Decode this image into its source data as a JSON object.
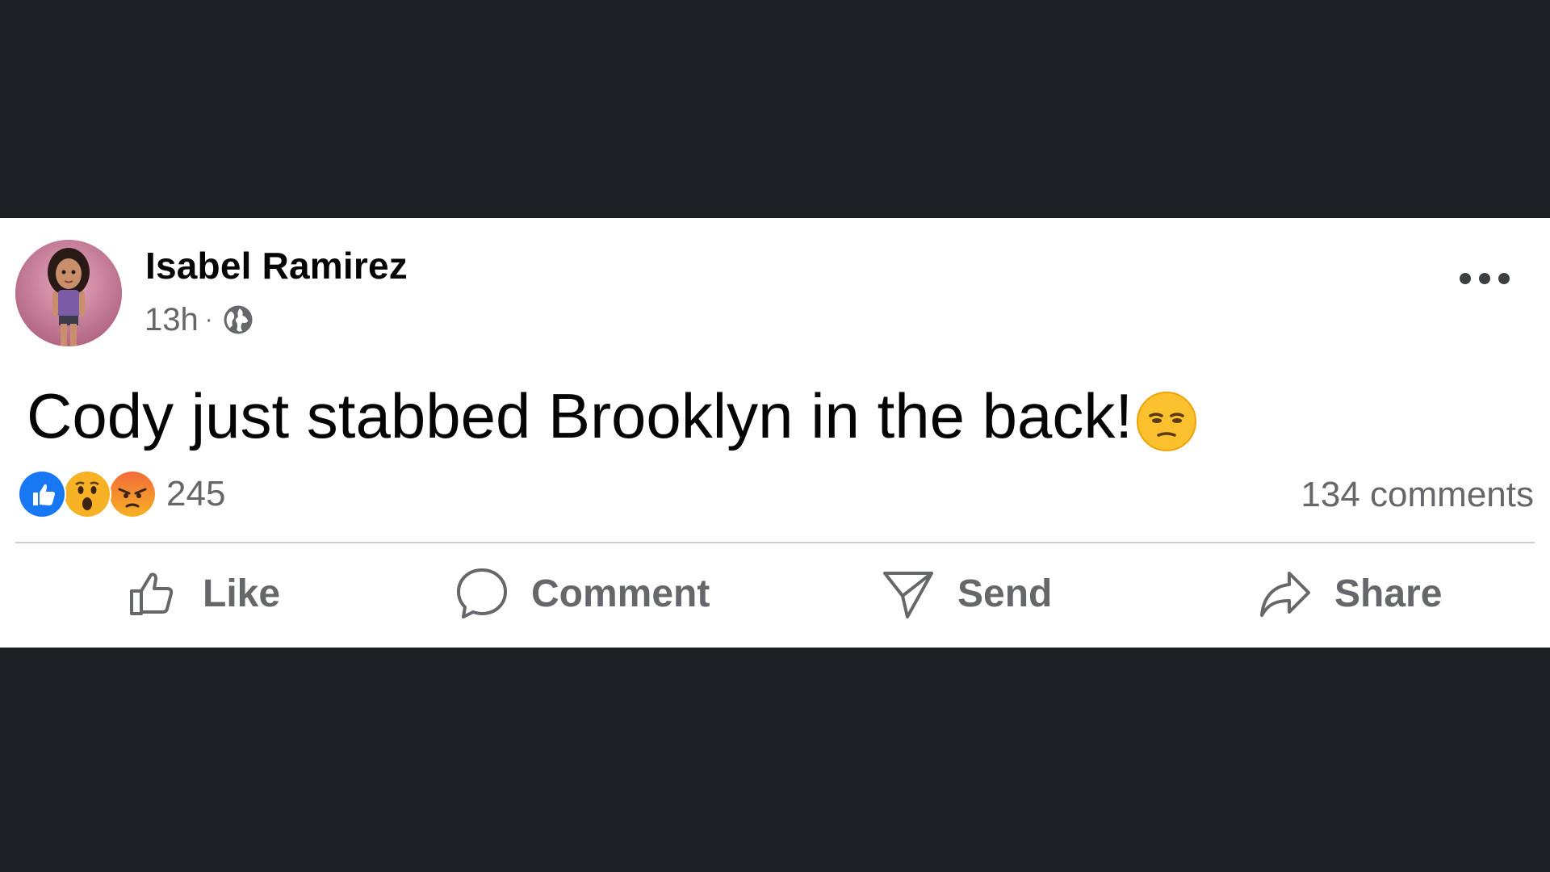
{
  "post": {
    "author": "Isabel Ramirez",
    "time": "13h",
    "separator": "·",
    "privacy_icon": "globe-icon",
    "text": "Cody just stabbed Brooklyn in the back!",
    "emoji_icon": "unamused-face-emoji",
    "reactions": {
      "icons": [
        "like-reaction-icon",
        "wow-reaction-icon",
        "angry-reaction-icon"
      ],
      "count": "245"
    },
    "comments": "134 comments"
  },
  "actions": {
    "like": "Like",
    "comment": "Comment",
    "send": "Send",
    "share": "Share"
  },
  "colors": {
    "background": "#1d2125",
    "card": "#ffffff",
    "like_blue": "#1877f2",
    "muted_text": "#65676b",
    "angry_orange": "#e9710f",
    "reaction_yellow": "#f7b125"
  }
}
